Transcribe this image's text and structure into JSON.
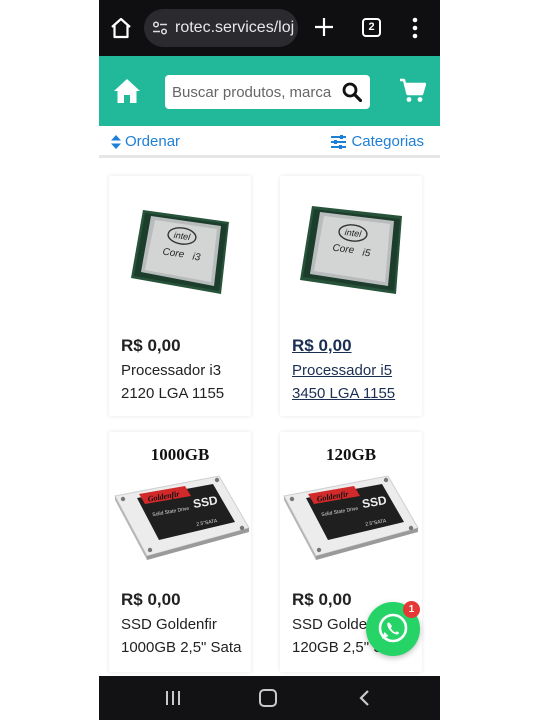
{
  "browser": {
    "url": "rotec.services/loj",
    "tab_count": "2"
  },
  "header": {
    "search_placeholder": "Buscar produtos, marca"
  },
  "toolbar": {
    "sort_label": "Ordenar",
    "categories_label": "Categorias"
  },
  "products": [
    {
      "price": "R$ 0,00",
      "name": "Processador i3 2120 LGA 1155",
      "brand": "intel",
      "line": "Core",
      "model": "i3"
    },
    {
      "price": "R$ 0,00",
      "name": "Processador i5 3450 LGA 1155",
      "brand": "intel",
      "line": "Core",
      "model": "i5"
    },
    {
      "price": "R$ 0,00",
      "name": "SSD Goldenfir 1000GB 2,5\" Sata",
      "capacity": "1000GB",
      "brand": "Goldenfir",
      "sub": "Solid State Drive",
      "type": "SSD",
      "spec": "2.5\"SATA"
    },
    {
      "price": "R$ 0,00",
      "name": "SSD Golden 120GB 2,5\" S",
      "capacity": "120GB",
      "brand": "Goldenfir",
      "sub": "Solid State Drive",
      "type": "SSD",
      "spec": "2.5\"SATA"
    }
  ],
  "whatsapp": {
    "badge": "1"
  },
  "colors": {
    "brand": "#22b99a",
    "link": "#1e7fd6",
    "whatsapp": "#25d366"
  }
}
